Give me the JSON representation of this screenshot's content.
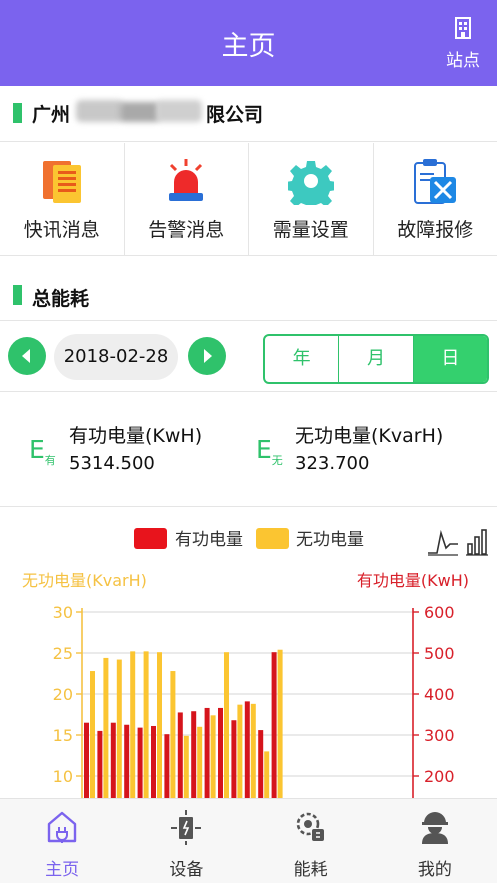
{
  "header": {
    "title": "主页",
    "station_label": "站点"
  },
  "company": {
    "name_prefix": "广州",
    "name_suffix": "限公司"
  },
  "quick_actions": [
    {
      "label": "快讯消息",
      "icon": "news-icon"
    },
    {
      "label": "告警消息",
      "icon": "alarm-icon"
    },
    {
      "label": "需量设置",
      "icon": "gear-icon"
    },
    {
      "label": "故障报修",
      "icon": "repair-icon"
    }
  ],
  "section": {
    "title": "总能耗"
  },
  "date_picker": {
    "date": "2018-02-28",
    "modes": [
      "年",
      "月",
      "日"
    ],
    "active_mode": "日"
  },
  "energy": {
    "active": {
      "icon_letter": "E",
      "icon_sub": "有",
      "title": "有功电量(KwH)",
      "value": "5314.500"
    },
    "reactive": {
      "icon_letter": "E",
      "icon_sub": "无",
      "title": "无功电量(KvarH)",
      "value": "323.700"
    }
  },
  "chart_data": {
    "type": "bar",
    "legend": [
      {
        "name": "有功电量",
        "color": "#e8141c"
      },
      {
        "name": "无功电量",
        "color": "#fbc531"
      }
    ],
    "left_axis": {
      "label": "无功电量(KvarH)",
      "color": "#f5c243",
      "ticks": [
        30,
        25,
        20,
        15,
        10
      ],
      "range": [
        0,
        30
      ]
    },
    "right_axis": {
      "label": "有功电量(KwH)",
      "color": "#d8202a",
      "ticks": [
        600,
        500,
        400,
        300,
        200
      ],
      "range": [
        0,
        600
      ]
    },
    "series": [
      {
        "name": "有功电量",
        "axis": "right",
        "color": "#d5141c",
        "values": [
          330,
          310,
          330,
          325,
          318,
          322,
          302,
          355,
          358,
          366,
          366,
          336,
          382,
          312,
          502
        ]
      },
      {
        "name": "无功电量",
        "axis": "left",
        "color": "#fbc531",
        "values": [
          22.8,
          24.4,
          24.2,
          25.2,
          25.2,
          25.1,
          22.8,
          14.9,
          16.0,
          17.4,
          25.1,
          18.7,
          18.8,
          13.0,
          25.4
        ]
      }
    ]
  },
  "tabs": [
    {
      "label": "主页",
      "icon": "home-icon",
      "active": true
    },
    {
      "label": "设备",
      "icon": "device-icon",
      "active": false
    },
    {
      "label": "能耗",
      "icon": "energy-icon",
      "active": false
    },
    {
      "label": "我的",
      "icon": "profile-icon",
      "active": false
    }
  ]
}
